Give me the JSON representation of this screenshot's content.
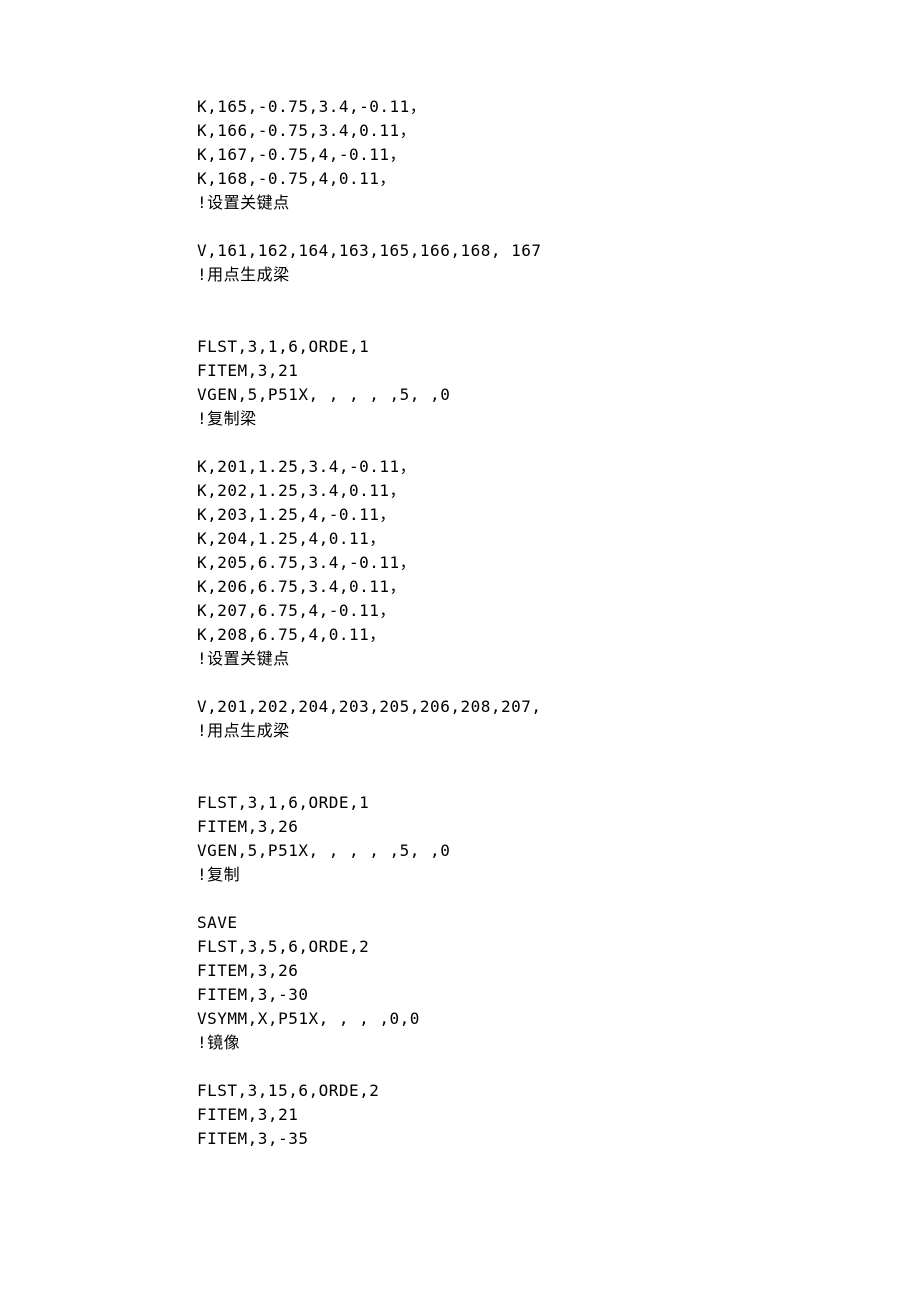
{
  "lines": [
    "K,165,-0.75,3.4,-0.11，",
    "K,166,-0.75,3.4,0.11，",
    "K,167,-0.75,4,-0.11，",
    "K,168,-0.75,4,0.11，",
    "!设置关键点",
    "",
    "V,161,162,164,163,165,166,168, 167",
    "!用点生成梁",
    "",
    "",
    "FLST,3,1,6,ORDE,1",
    "FITEM,3,21",
    "VGEN,5,P51X, , , , ,5, ,0",
    "!复制梁",
    "",
    "K,201,1.25,3.4,-0.11，",
    "K,202,1.25,3.4,0.11，",
    "K,203,1.25,4,-0.11，",
    "K,204,1.25,4,0.11，",
    "K,205,6.75,3.4,-0.11，",
    "K,206,6.75,3.4,0.11，",
    "K,207,6.75,4,-0.11，",
    "K,208,6.75,4,0.11，",
    "!设置关键点",
    "",
    "V,201,202,204,203,205,206,208,207,",
    "!用点生成梁",
    "",
    "",
    "FLST,3,1,6,ORDE,1",
    "FITEM,3,26",
    "VGEN,5,P51X, , , , ,5, ,0",
    "!复制",
    "",
    "SAVE",
    "FLST,3,5,6,ORDE,2",
    "FITEM,3,26",
    "FITEM,3,-30",
    "VSYMM,X,P51X, , , ,0,0",
    "!镜像",
    "",
    "FLST,3,15,6,ORDE,2",
    "FITEM,3,21",
    "FITEM,3,-35"
  ]
}
